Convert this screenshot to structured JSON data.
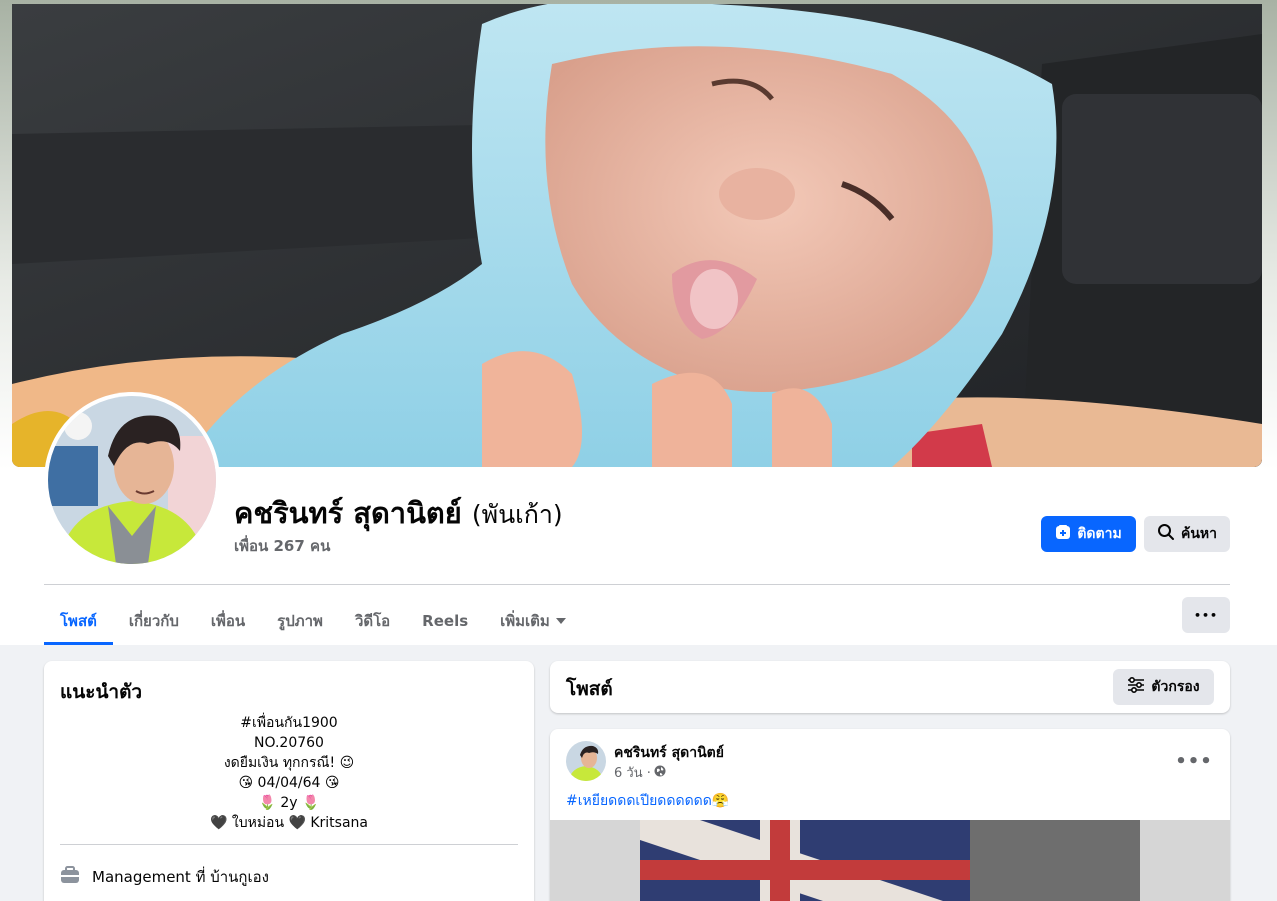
{
  "profile": {
    "name": "คชรินทร์ สุดานิตย์",
    "alt_name": "(พันเก้า)",
    "friends": "เพื่อน 267 คน"
  },
  "actions": {
    "follow_label": "ติดตาม",
    "search_label": "ค้นหา",
    "more_label": "•••"
  },
  "tabs": [
    {
      "label": "โพสต์"
    },
    {
      "label": "เกี่ยวกับ"
    },
    {
      "label": "เพื่อน"
    },
    {
      "label": "รูปภาพ"
    },
    {
      "label": "วิดีโอ"
    },
    {
      "label": "Reels"
    },
    {
      "label": "เพิ่มเติม"
    }
  ],
  "intro": {
    "title": "แนะนำตัว",
    "bio_lines": [
      "#เพื่อนกัน1900",
      "NO.20760",
      "งดยืมเงิน ทุกกรณี! 😉",
      "😘 04/04/64 😘",
      "🌷 2y 🌷",
      "🖤 ใบหม่อน 🖤 Kritsana"
    ],
    "work": "Management ที่ บ้านกูเอง"
  },
  "posts_section": {
    "title": "โพสต์",
    "filter_label": "ตัวกรอง"
  },
  "post": {
    "author": "คชรินทร์ สุดานิตย์",
    "time": "6 วัน ·",
    "text": "#เหยียดดดเปียดดดดดด😤",
    "more_label": "•••"
  },
  "colors": {
    "accent": "#0866ff",
    "background": "#f0f2f5",
    "secondary_text": "#65676b",
    "button_gray": "#e4e6eb"
  },
  "icons": {
    "follow": "add-friend-icon",
    "search": "search-icon",
    "filter": "filter-sliders-icon",
    "work": "briefcase-icon",
    "privacy": "globe-icon"
  }
}
